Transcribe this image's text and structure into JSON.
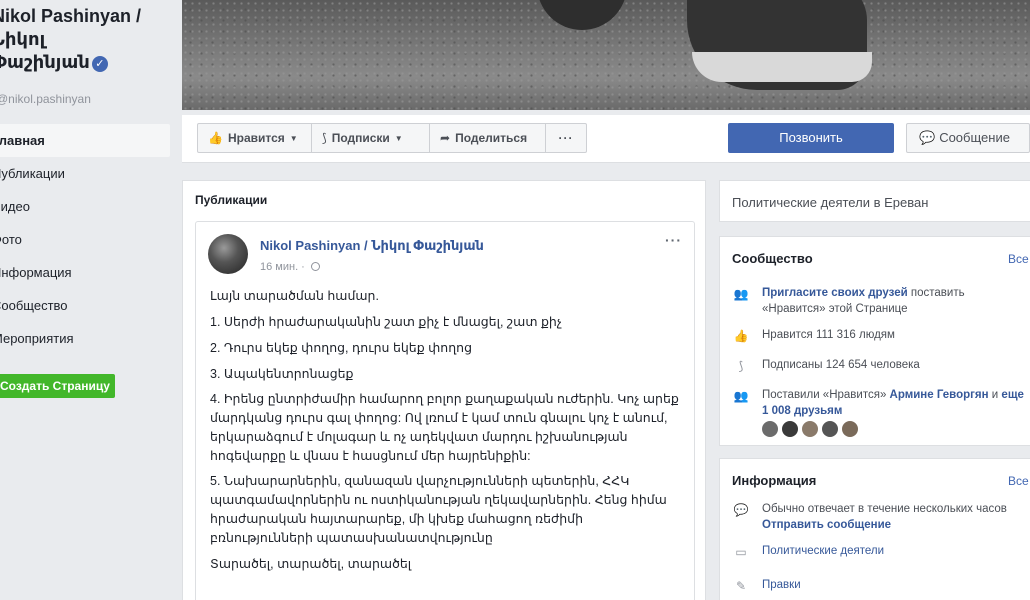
{
  "page": {
    "name": "Nikol Pashinyan / Նիկոլ Փաշինյան",
    "name_line1": "Nikol Pashinyan /",
    "name_line2": "Նիկոլ",
    "name_line3": "Փաշինյան",
    "verified_mark": "✓",
    "handle": "@nikol.pashinyan"
  },
  "nav": {
    "items": [
      {
        "label": "Главная",
        "active": true
      },
      {
        "label": "Публикации"
      },
      {
        "label": "Видео"
      },
      {
        "label": "Фото"
      },
      {
        "label": "Информация"
      },
      {
        "label": "Сообщество"
      },
      {
        "label": "Мероприятия"
      }
    ],
    "create_page_label": "Создать Страницу"
  },
  "action_bar": {
    "like_label": "Нравится",
    "subscribe_label": "Подписки",
    "share_label": "Поделиться",
    "more_label": "···",
    "call_label": "Позвонить",
    "message_label": "Сообщение"
  },
  "publications": {
    "title": "Публикации",
    "post": {
      "author": "Nikol Pashinyan / Նիկոլ Փաշինյան",
      "time": "16 мин. · ",
      "menu": "···",
      "paragraphs": [
        "Լայն տարածման համար.",
        "1. Սերժի հրաժարականին շատ քիչ է մնացել, շատ քիչ",
        "2. Դուրս եկեք փողոց, դուրս եկեք փողոց",
        "3. Ապակենտրոնացեք",
        "4. Իրենց ընտրիժամիր համարող բոլոր քաղաքական ուժերին. Կոչ արեք մարդկանց դուրս գալ փողոց: Ով լռում է կամ տուն գնալու կոչ է անում, երկարաձգում է մոլագար և ոչ ադեկվատ մարդու իշխանության հոգեվարքը և վնաս է հասցնում մեր հայրենիքին:",
        "5. Նախարարներին, զանազան վարչությունների պետերին, ՀՀԿ պատգամավորներին ու ոստիկանության ղեկավարներին. Հենց հիմա հրաժարական հայտարարեք, մի կխեք մահացող ռեժիմի բռնությունների պատասխանատվությունը",
        "Տարածել, տարածել, տարածել"
      ]
    }
  },
  "sidebar_right": {
    "category": "Политические деятели в Ереван",
    "community": {
      "title": "Сообщество",
      "all_label": "Все",
      "invite_link": "Пригласите своих друзей",
      "invite_rest": " поставить «Нравится» этой Странице",
      "likes_text": "Нравится 111 316 людям",
      "followers_text": "Подписаны 124 654 человека",
      "friends_prefix": "Поставили «Нравится» ",
      "friends_name": "Армине Геворгян",
      "friends_and": " и ",
      "friends_more": "еще 1 008 друзьям"
    },
    "info": {
      "title": "Информация",
      "all_label": "Все",
      "response_text": "Обычно отвечает в течение нескольких часов",
      "send_message": "Отправить сообщение",
      "category_link": "Политические деятели",
      "edits_link": "Правки"
    }
  },
  "colors": {
    "brand_blue": "#4267b2",
    "link_blue": "#365899",
    "green_button": "#42b72a",
    "background": "#e9ebee"
  }
}
